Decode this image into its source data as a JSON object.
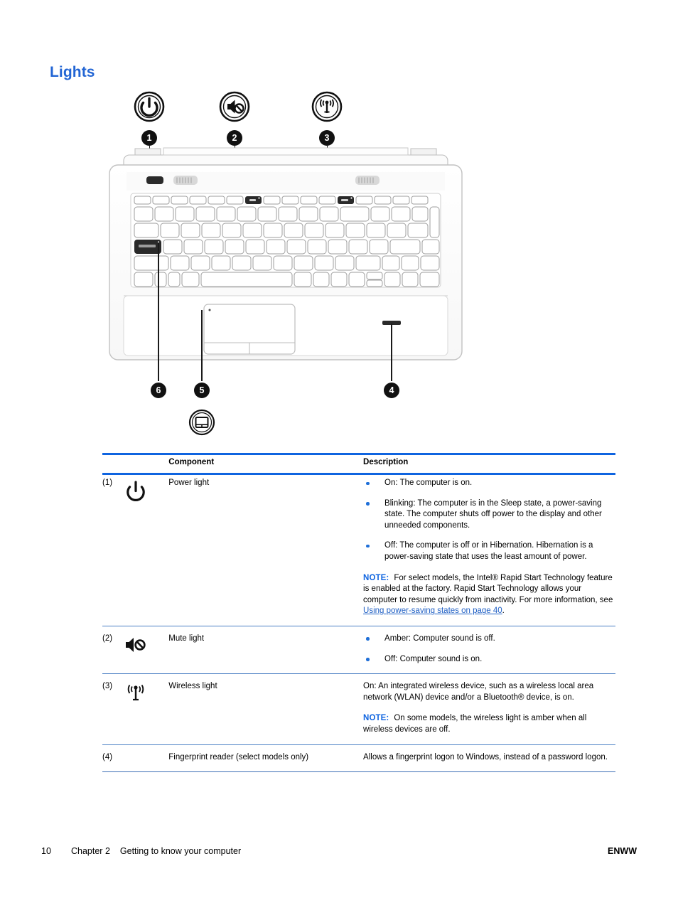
{
  "document": {
    "heading": "Lights"
  },
  "figure": {
    "top_icons": [
      {
        "name": "power-light-icon",
        "callout": "1"
      },
      {
        "name": "mute-light-icon",
        "callout": "2"
      },
      {
        "name": "wireless-light-icon",
        "callout": "3"
      }
    ],
    "bottom_callouts": [
      {
        "callout": "6",
        "name": "caps-lock-light-callout"
      },
      {
        "callout": "5",
        "name": "touchpad-light-callout",
        "icon": "touchpad-icon"
      },
      {
        "callout": "4",
        "name": "fingerprint-reader-callout"
      }
    ],
    "device": "laptop-top-view-illustration"
  },
  "table": {
    "headers": {
      "component": "Component",
      "description": "Description"
    },
    "rows": [
      {
        "number": "(1)",
        "icon": "power-icon",
        "name": "Power light",
        "bullets": [
          "On: The computer is on.",
          "Blinking: The computer is in the Sleep state, a power-saving state. The computer shuts off power to the display and other unneeded components.",
          "Off: The computer is off or in Hibernation. Hibernation is a power-saving state that uses the least amount of power."
        ],
        "note": {
          "label": "NOTE:",
          "text_before": "For select models, the Intel® Rapid Start Technology feature is enabled at the factory. Rapid Start Technology allows your computer to resume quickly from inactivity. For more information, see ",
          "link": "Using power-saving states on page 40",
          "text_after": "."
        }
      },
      {
        "number": "(2)",
        "icon": "mute-icon",
        "name": "Mute light",
        "bullets": [
          "Amber: Computer sound is off.",
          "Off: Computer sound is on."
        ]
      },
      {
        "number": "(3)",
        "icon": "wireless-icon",
        "name": "Wireless light",
        "paragraph": "On: An integrated wireless device, such as a wireless local area network (WLAN) device and/or a Bluetooth® device, is on.",
        "note": {
          "label": "NOTE:",
          "text_before": "On some models, the wireless light is amber when all wireless devices are off.",
          "link": "",
          "text_after": ""
        }
      },
      {
        "number": "(4)",
        "icon": "",
        "name": "Fingerprint reader (select models only)",
        "paragraph": "Allows a fingerprint logon to Windows, instead of a password logon."
      }
    ]
  },
  "footer": {
    "page_number": "10",
    "chapter": "Chapter 2",
    "chapter_title": "Getting to know your computer",
    "locale": "ENWW"
  },
  "colors": {
    "heading_blue": "#2265d4",
    "rule_blue": "#0f64e0",
    "link_blue": "#1f5fc4",
    "bullet_blue": "#1f6fd8"
  }
}
